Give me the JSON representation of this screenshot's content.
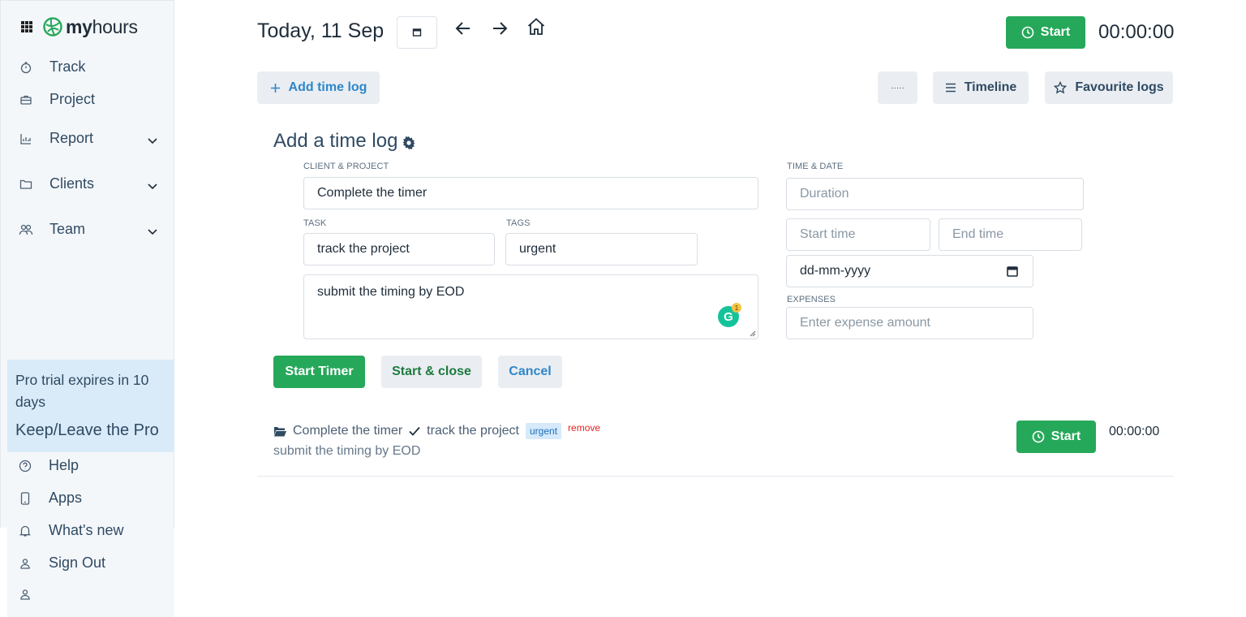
{
  "sidebar": {
    "brand_bold": "my",
    "brand_rest": "hours",
    "nav": {
      "track": "Track",
      "project": "Project",
      "report": "Report",
      "clients": "Clients",
      "team": "Team"
    },
    "promo": {
      "text": "Pro trial expires in 10 days",
      "link": "Keep/Leave the Pro"
    },
    "bottom": {
      "help": "Help",
      "apps": "Apps",
      "whats_new": "What's new",
      "sign_out": "Sign Out"
    }
  },
  "header": {
    "date_title": "Today, 11 Sep",
    "start_label": "Start",
    "timer": "00:00:00"
  },
  "toolbar": {
    "add_time_log": "Add time log",
    "more": "·····",
    "timeline": "Timeline",
    "favourite_logs": "Favourite logs"
  },
  "form": {
    "title": "Add a time log",
    "client_project_label": "CLIENT & PROJECT",
    "client_project_value": "Complete the timer",
    "task_label": "TASK",
    "task_value": "track the project",
    "tags_label": "TAGS",
    "tags_value": "urgent",
    "notes_value": "submit the timing by EOD",
    "grammarly_badge": "1",
    "time_date_label": "TIME & DATE",
    "duration_placeholder": "Duration",
    "start_time_placeholder": "Start time",
    "end_time_placeholder": "End time",
    "date_placeholder": "dd-mm-yyyy",
    "expenses_label": "EXPENSES",
    "expense_placeholder": "Enter expense amount",
    "start_timer": "Start Timer",
    "start_close": "Start & close",
    "cancel": "Cancel"
  },
  "log": {
    "project": "Complete the timer",
    "task": "track the project",
    "tag": "urgent",
    "remove": "remove",
    "note": "submit the timing by EOD",
    "start_label": "Start",
    "timer": "00:00:00"
  },
  "colors": {
    "green": "#26a85a",
    "sidebar_bg": "#f4f7fa",
    "promo_bg": "#d9ebf9",
    "button_light": "#eaeef2",
    "tag_bg": "#d6eafc",
    "remove_red": "#e02424"
  },
  "icons": [
    "apps-grid-icon",
    "myhours-logo-icon",
    "stopwatch-icon",
    "briefcase-icon",
    "bar-chart-icon",
    "folder-icon",
    "team-icon",
    "chevron-down-icon",
    "help-icon",
    "phone-icon",
    "bell-icon",
    "user-icon",
    "calendar-icon",
    "arrow-left-icon",
    "arrow-right-icon",
    "home-icon",
    "clock-icon",
    "plus-icon",
    "list-icon",
    "star-icon",
    "gear-icon",
    "folder-open-icon",
    "check-icon"
  ]
}
